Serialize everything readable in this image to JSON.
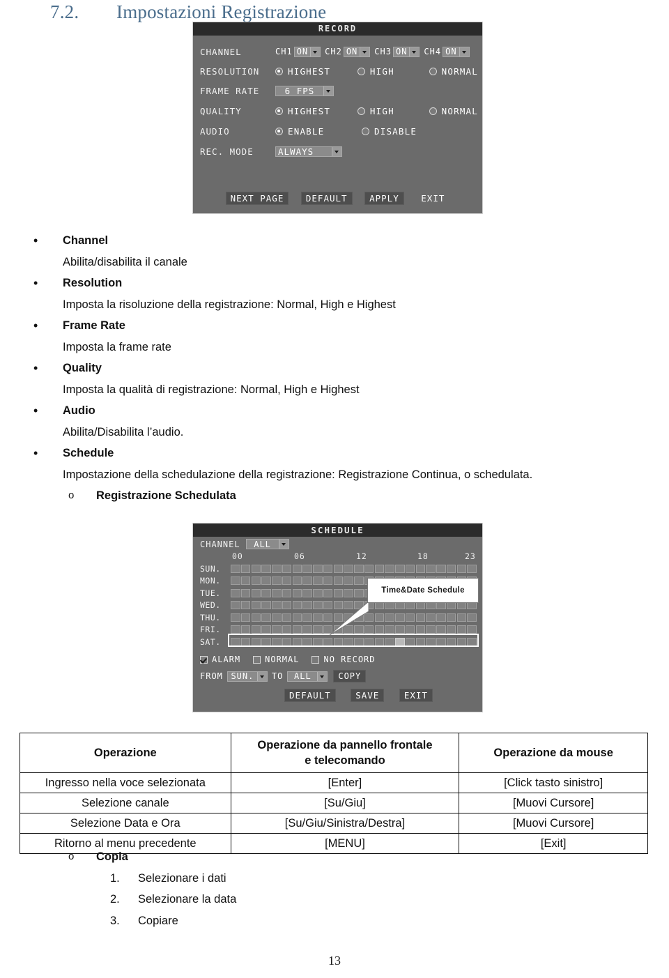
{
  "heading": {
    "number": "7.2.",
    "title": "Impostazioni Registrazione"
  },
  "record_screen": {
    "title": "RECORD",
    "channel_label": "CHANNEL",
    "channels": [
      {
        "name": "CH1",
        "value": "ON"
      },
      {
        "name": "CH2",
        "value": "ON"
      },
      {
        "name": "CH3",
        "value": "ON"
      },
      {
        "name": "CH4",
        "value": "ON"
      }
    ],
    "resolution_label": "RESOLUTION",
    "resolution_options": [
      "HIGHEST",
      "HIGH",
      "NORMAL"
    ],
    "resolution_selected": "HIGHEST",
    "frame_rate_label": "FRAME RATE",
    "frame_rate_value": "6 FPS",
    "quality_label": "QUALITY",
    "quality_options": [
      "HIGHEST",
      "HIGH",
      "NORMAL"
    ],
    "quality_selected": "HIGHEST",
    "audio_label": "AUDIO",
    "audio_options": [
      "ENABLE",
      "DISABLE"
    ],
    "audio_selected": "ENABLE",
    "rec_mode_label": "REC. MODE",
    "rec_mode_value": "ALWAYS",
    "buttons": [
      "NEXT PAGE",
      "DEFAULT",
      "APPLY",
      "EXIT"
    ]
  },
  "schedule_screen": {
    "title": "SCHEDULE",
    "channel_label": "CHANNEL",
    "channel_value": "ALL",
    "hour_ticks": [
      "00",
      "06",
      "12",
      "18",
      "23"
    ],
    "days": [
      "SUN.",
      "MON.",
      "TUE.",
      "WED.",
      "THU.",
      "FRI.",
      "SAT."
    ],
    "callout": "Time&Date Schedule",
    "legend": [
      {
        "label": "ALARM",
        "checked": true
      },
      {
        "label": "NORMAL",
        "checked": false
      },
      {
        "label": "NO RECORD",
        "checked": false
      }
    ],
    "from_label": "FROM",
    "from_value": "SUN.",
    "to_label": "TO",
    "to_value": "ALL",
    "copy_label": "COPY",
    "buttons": [
      "DEFAULT",
      "SAVE",
      "EXIT"
    ]
  },
  "items": [
    {
      "term": "Channel",
      "desc": "Abilita/disabilita il canale"
    },
    {
      "term": "Resolution",
      "desc": "Imposta la risoluzione della registrazione: Normal, High e Highest"
    },
    {
      "term": "Frame Rate",
      "desc": "Imposta la frame rate"
    },
    {
      "term": "Quality",
      "desc": "Imposta la qualità di registrazione: Normal, High e Highest"
    },
    {
      "term": "Audio",
      "desc": "Abilita/Disabilita l’audio."
    },
    {
      "term": "Schedule",
      "desc": "Impostazione della schedulazione della registrazione: Registrazione Continua, o schedulata."
    }
  ],
  "sub_item": "Registrazione Schedulata",
  "table": {
    "headers": [
      "Operazione",
      "Operazione da pannello frontale e telecomando",
      "Operazione da mouse"
    ],
    "header_lines": {
      "col2_line1": "Operazione da pannello frontale",
      "col2_line2": "e telecomando"
    },
    "rows": [
      [
        "Ingresso nella voce selezionata",
        "[Enter]",
        "[Click tasto sinistro]"
      ],
      [
        "Selezione canale",
        "[Su/Giu]",
        "[Muovi Cursore]"
      ],
      [
        "Selezione Data e Ora",
        "[Su/Giu/Sinistra/Destra]",
        "[Muovi Cursore]"
      ],
      [
        "Ritorno al menu precedente",
        "[MENU]",
        "[Exit]"
      ]
    ]
  },
  "copia": {
    "title": "Copia",
    "steps": [
      {
        "n": "1.",
        "text": "Selezionare i dati"
      },
      {
        "n": "2.",
        "text": "Selezionare la data"
      },
      {
        "n": "3.",
        "text": "Copiare"
      }
    ]
  },
  "page_number": "13"
}
